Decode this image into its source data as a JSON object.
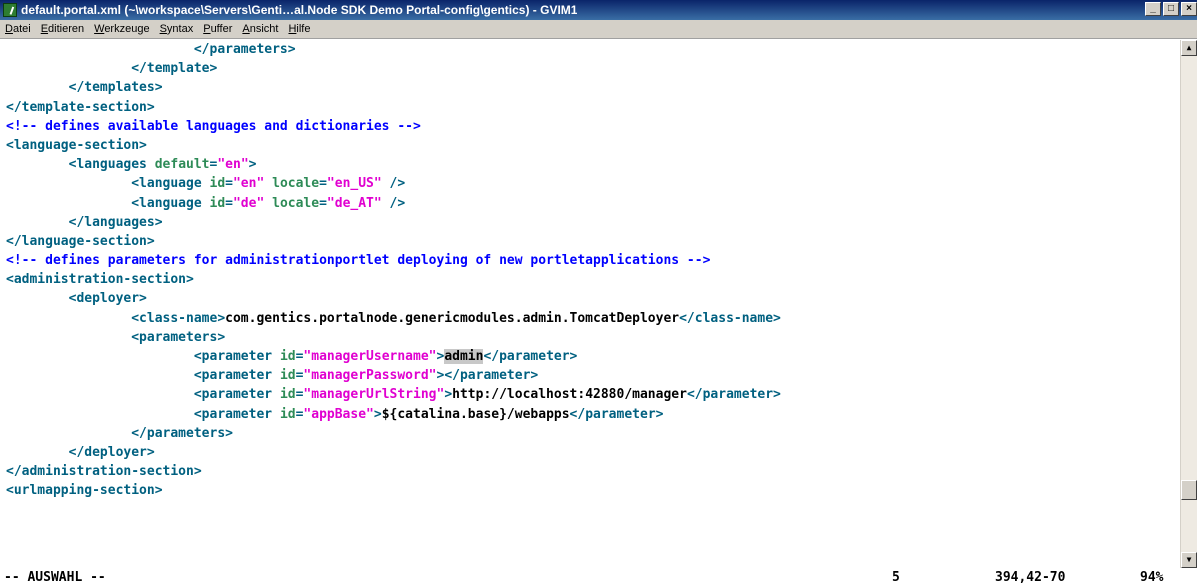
{
  "window": {
    "title": "default.portal.xml (~\\workspace\\Servers\\Genti…al.Node SDK Demo Portal-config\\gentics) - GVIM1",
    "controls": {
      "minimize": "_",
      "maximize": "□",
      "close": "×"
    }
  },
  "menu": [
    "Datei",
    "Editieren",
    "Werkzeuge",
    "Syntax",
    "Puffer",
    "Ansicht",
    "Hilfe"
  ],
  "editor": {
    "lines": [
      "                        </parameters>",
      "                </template>",
      "        </templates>",
      "</template-section>",
      "<!-- defines available languages and dictionaries -->",
      "<language-section>",
      "        <languages",
      "default",
      "\"en\"",
      ">",
      "                <language",
      "id",
      "\"en\"",
      "locale",
      "\"en_US\"",
      "/>",
      "\"de\"",
      "\"de_AT\"",
      "        </languages>",
      "</language-section>",
      "<!-- defines parameters for administrationportlet deploying of new portletapplications -->",
      "<administration-section>",
      "        <deployer>",
      "                <class-name>",
      "com.gentics.portalnode.genericmodules.admin.TomcatDeployer",
      "</class-name>",
      "                <parameters>",
      "                        <parameter",
      "\"managerUsername\"",
      "admin",
      "</parameter>",
      "\"managerPassword\"",
      "\"managerUrlString\"",
      "http://localhost:42880/manager",
      "\"appBase\"",
      "${catalina.base}/webapps",
      "                </parameters>",
      "        </deployer>",
      "</administration-section>",
      "<urlmapping-section>"
    ]
  },
  "status": {
    "mode": "-- AUSWAHL --",
    "count": "5",
    "position": "394,42-70",
    "percent": "94%"
  },
  "colors": {
    "tag": "#006080",
    "attribute": "#2e8b57",
    "value": "#e000d0",
    "comment": "#0000ff",
    "text": "#000000"
  },
  "scrollbar": {
    "up": "▲",
    "down": "▼"
  }
}
